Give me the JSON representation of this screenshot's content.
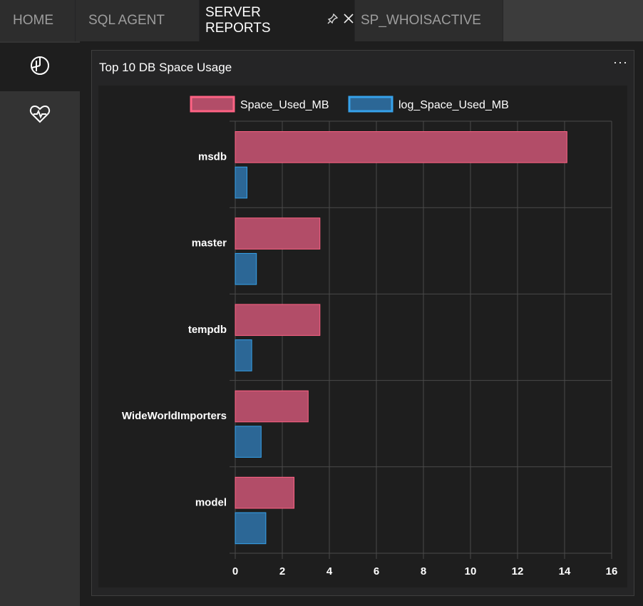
{
  "tabs": [
    {
      "label": "HOME"
    },
    {
      "label": "SQL AGENT"
    },
    {
      "label": "SERVER REPORTS"
    },
    {
      "label": "SP_WHOISACTIVE"
    }
  ],
  "sidebar": {
    "items": [
      {
        "icon": "pie-chart-icon"
      },
      {
        "icon": "heart-pulse-icon"
      }
    ]
  },
  "panel": {
    "title": "Top 10 DB Space Usage",
    "menu": "···"
  },
  "colors": {
    "space_used": "#b24d68",
    "space_used_border": "#ff6384",
    "log_space_used": "#2c6796",
    "log_space_used_border": "#36a2eb",
    "grid": "#4a4a4a"
  },
  "chart_data": {
    "type": "bar",
    "orientation": "horizontal",
    "categories": [
      "msdb",
      "master",
      "tempdb",
      "WideWorldImporters",
      "model"
    ],
    "series": [
      {
        "name": "Space_Used_MB",
        "values": [
          14.1,
          3.6,
          3.6,
          3.1,
          2.5
        ]
      },
      {
        "name": "log_Space_Used_MB",
        "values": [
          0.5,
          0.9,
          0.7,
          1.1,
          1.3
        ]
      }
    ],
    "xlim": [
      0,
      16
    ],
    "xticks": [
      "0",
      "2",
      "4",
      "6",
      "8",
      "10",
      "12",
      "14",
      "16"
    ],
    "legend": "top",
    "grid": true
  }
}
